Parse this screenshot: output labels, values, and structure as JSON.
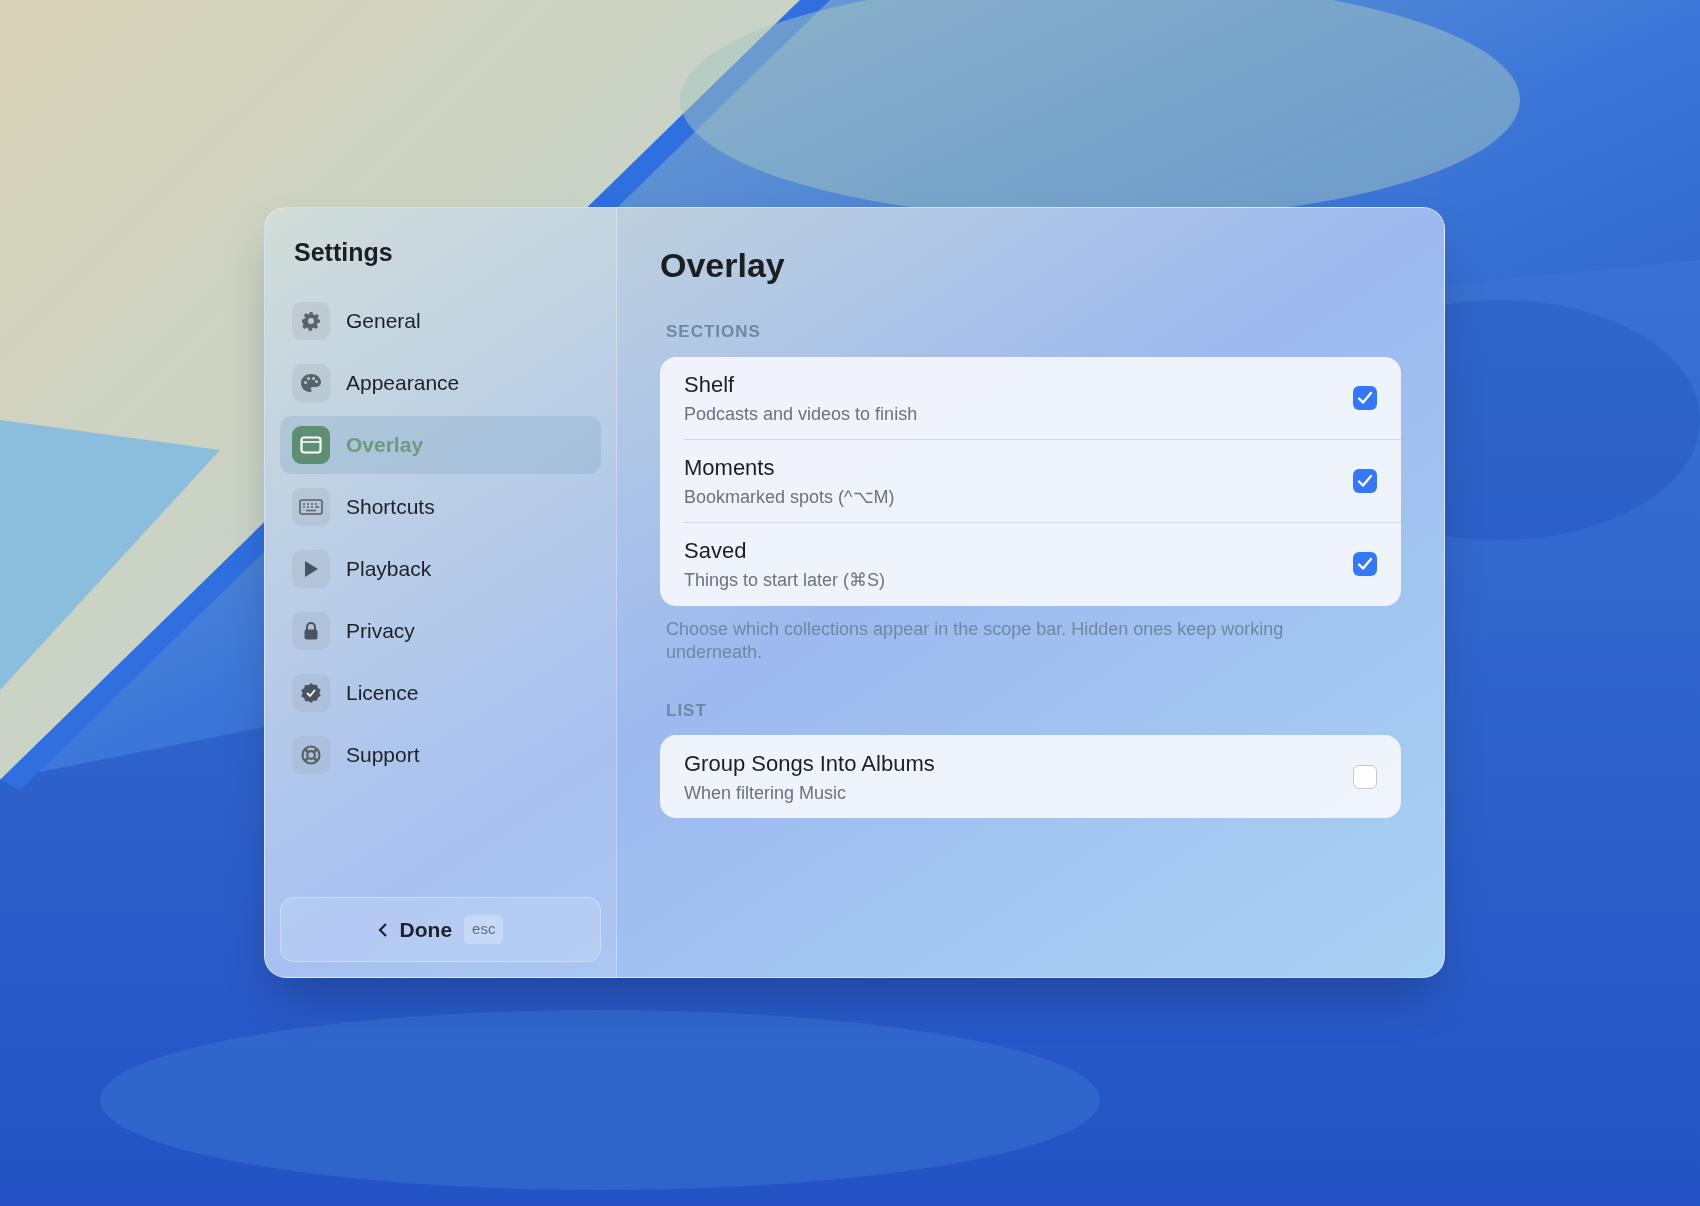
{
  "sidebar": {
    "title": "Settings",
    "items": [
      {
        "label": "General",
        "selected": false
      },
      {
        "label": "Appearance",
        "selected": false
      },
      {
        "label": "Overlay",
        "selected": true
      },
      {
        "label": "Shortcuts",
        "selected": false
      },
      {
        "label": "Playback",
        "selected": false
      },
      {
        "label": "Privacy",
        "selected": false
      },
      {
        "label": "Licence",
        "selected": false
      },
      {
        "label": "Support",
        "selected": false
      }
    ],
    "done_button": {
      "label": "Done",
      "shortcut": "esc"
    }
  },
  "content": {
    "title": "Overlay",
    "groups": [
      {
        "heading": "SECTIONS",
        "rows": [
          {
            "title": "Shelf",
            "subtitle": "Podcasts and videos to finish",
            "checked": true
          },
          {
            "title": "Moments",
            "subtitle": "Bookmarked spots (^⌥M)",
            "checked": true
          },
          {
            "title": "Saved",
            "subtitle": "Things to start later (⌘S)",
            "checked": true
          }
        ],
        "footnote": "Choose which collections appear in the scope bar. Hidden ones keep working underneath."
      },
      {
        "heading": "LIST",
        "rows": [
          {
            "title": "Group Songs Into Albums",
            "subtitle": "When filtering Music",
            "checked": false
          }
        ]
      }
    ]
  }
}
